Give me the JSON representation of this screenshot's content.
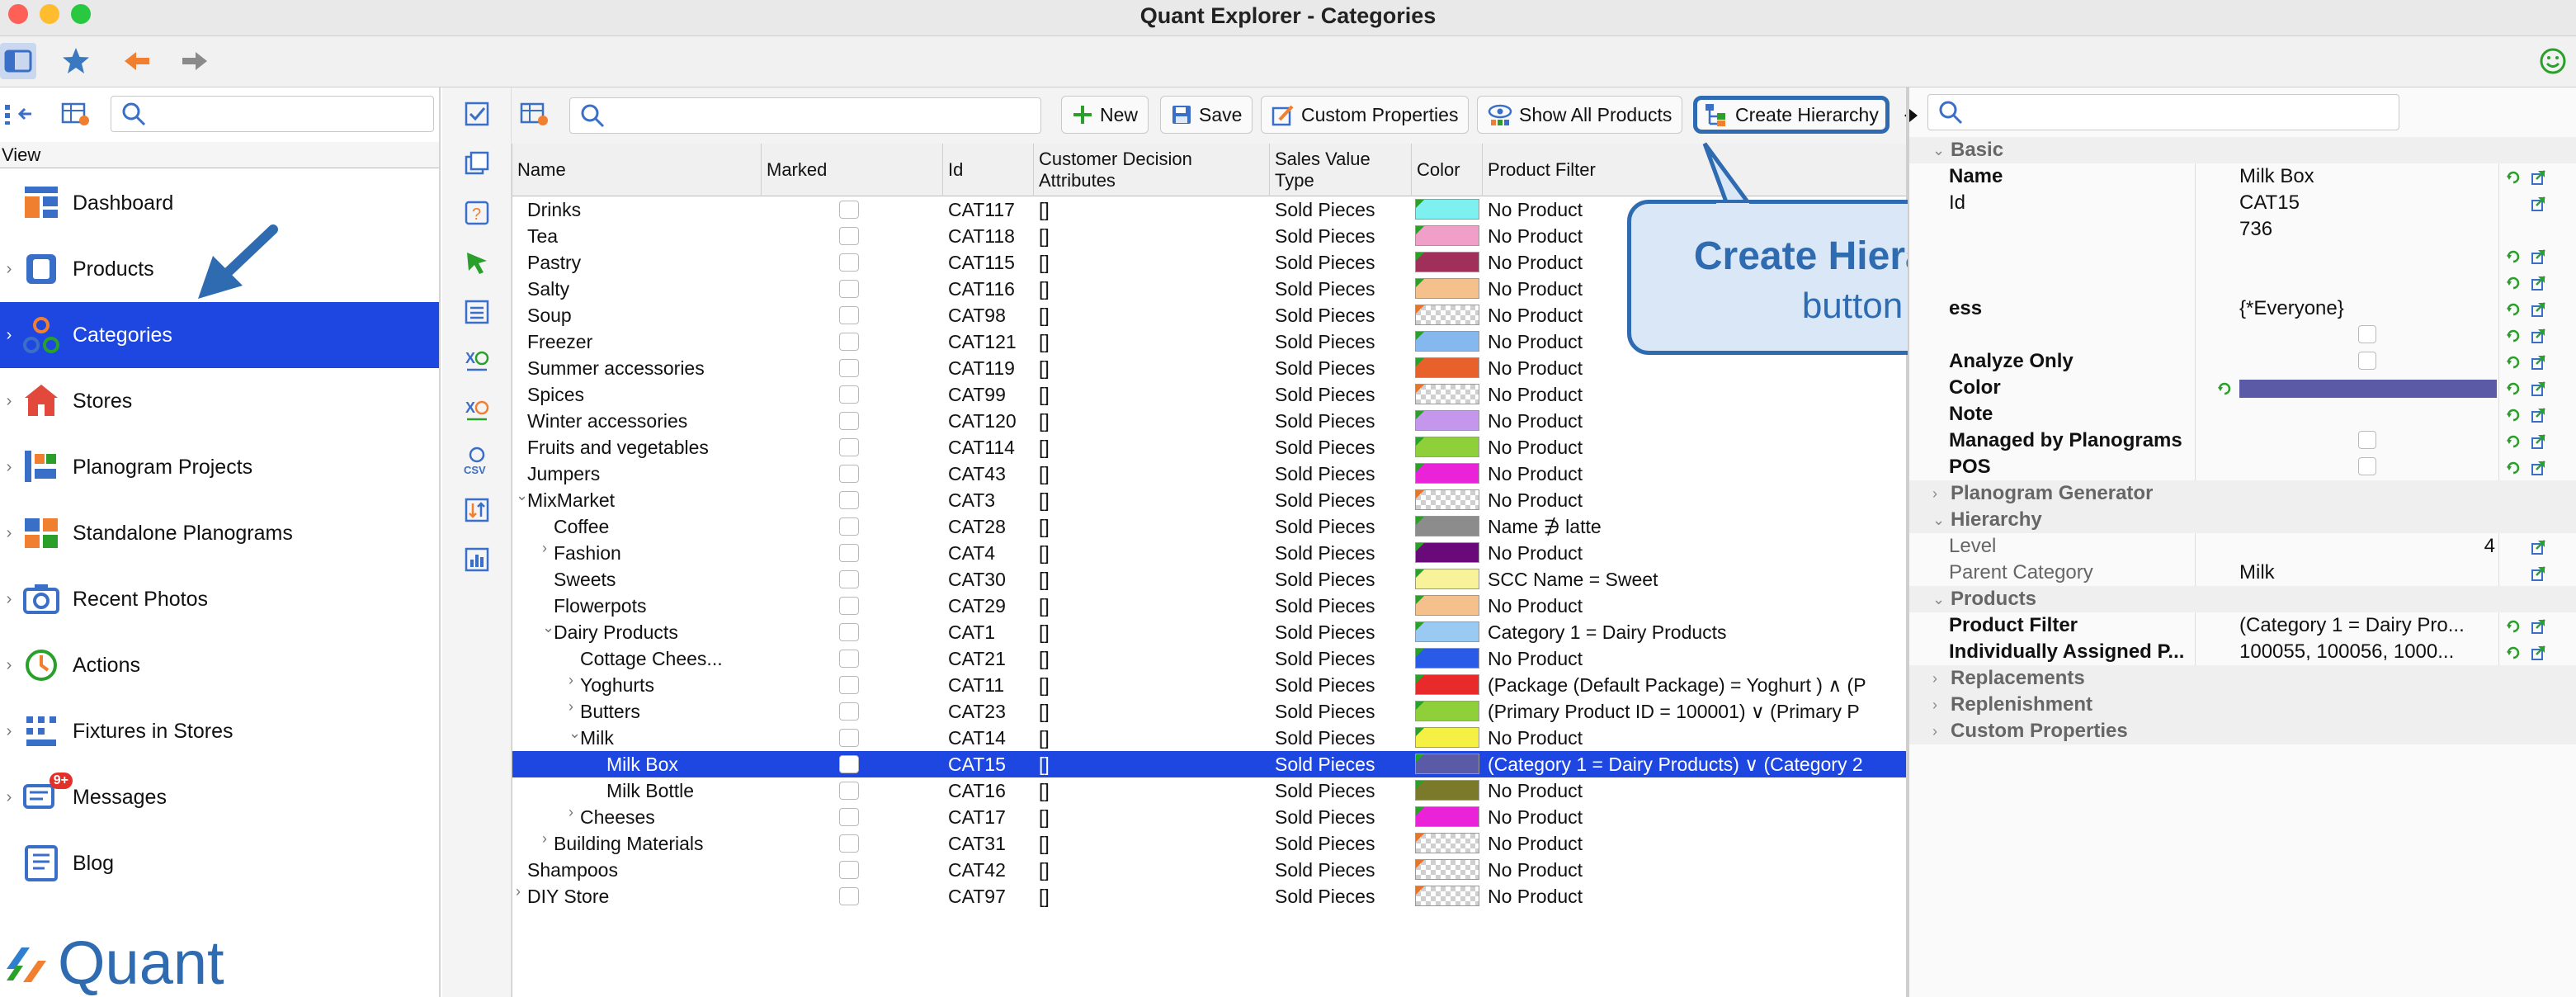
{
  "window": {
    "title": "Quant Explorer - Categories"
  },
  "left": {
    "view_label": "View",
    "nav": [
      {
        "label": "Dashboard",
        "icon": "dashboard-icon",
        "chevron": false
      },
      {
        "label": "Products",
        "icon": "products-icon",
        "chevron": true
      },
      {
        "label": "Categories",
        "icon": "categories-icon",
        "chevron": true,
        "selected": true
      },
      {
        "label": "Stores",
        "icon": "stores-icon",
        "chevron": true
      },
      {
        "label": "Planogram Projects",
        "icon": "planogram-projects-icon",
        "chevron": true
      },
      {
        "label": "Standalone Planograms",
        "icon": "standalone-planograms-icon",
        "chevron": true
      },
      {
        "label": "Recent Photos",
        "icon": "camera-icon",
        "chevron": true
      },
      {
        "label": "Actions",
        "icon": "actions-icon",
        "chevron": true
      },
      {
        "label": "Fixtures in Stores",
        "icon": "fixtures-icon",
        "chevron": true
      },
      {
        "label": "Messages",
        "icon": "messages-icon",
        "chevron": true,
        "badge": "9+"
      },
      {
        "label": "Blog",
        "icon": "blog-icon",
        "chevron": false
      }
    ],
    "logo_text": "Quant"
  },
  "center": {
    "buttons": {
      "new": "New",
      "save": "Save",
      "custom_properties": "Custom Properties",
      "show_all_products": "Show All Products",
      "create_hierarchy": "Create Hierarchy"
    },
    "columns": {
      "name": "Name",
      "marked": "Marked",
      "id": "Id",
      "cda_1": "Customer Decision",
      "cda_2": "Attributes",
      "svt_1": "Sales Value",
      "svt_2": "Type",
      "color": "Color",
      "filter": "Product Filter"
    },
    "rows": [
      {
        "name": "Drinks",
        "id": "CAT117",
        "cda": "[]",
        "svt": "Sold Pieces",
        "color": "#7ef0f0",
        "filter": "No Product",
        "indent": 0,
        "tw": ""
      },
      {
        "name": "Tea",
        "id": "CAT118",
        "cda": "[]",
        "svt": "Sold Pieces",
        "color": "#f0a0c8",
        "filter": "No Product",
        "indent": 0,
        "tw": ""
      },
      {
        "name": "Pastry",
        "id": "CAT115",
        "cda": "[]",
        "svt": "Sold Pieces",
        "color": "#a0305a",
        "filter": "No Product",
        "indent": 0,
        "tw": ""
      },
      {
        "name": "Salty",
        "id": "CAT116",
        "cda": "[]",
        "svt": "Sold Pieces",
        "color": "#f4c08c",
        "filter": "No Product",
        "indent": 0,
        "tw": ""
      },
      {
        "name": "Soup",
        "id": "CAT98",
        "cda": "[]",
        "svt": "Sold Pieces",
        "color": "checker",
        "filter": "No Product",
        "indent": 0,
        "tw": ""
      },
      {
        "name": "Freezer",
        "id": "CAT121",
        "cda": "[]",
        "svt": "Sold Pieces",
        "color": "#86b8f0",
        "filter": "No Product",
        "indent": 0,
        "tw": ""
      },
      {
        "name": "Summer accessories",
        "id": "CAT119",
        "cda": "[]",
        "svt": "Sold Pieces",
        "color": "#e8602a",
        "filter": "No Product",
        "indent": 0,
        "tw": ""
      },
      {
        "name": "Spices",
        "id": "CAT99",
        "cda": "[]",
        "svt": "Sold Pieces",
        "color": "checker",
        "filter": "No Product",
        "indent": 0,
        "tw": ""
      },
      {
        "name": "Winter accessories",
        "id": "CAT120",
        "cda": "[]",
        "svt": "Sold Pieces",
        "color": "#c496ec",
        "filter": "No Product",
        "indent": 0,
        "tw": ""
      },
      {
        "name": "Fruits and vegetables",
        "id": "CAT114",
        "cda": "[]",
        "svt": "Sold Pieces",
        "color": "#8ecf3a",
        "filter": "No Product",
        "indent": 0,
        "tw": ""
      },
      {
        "name": "Jumpers",
        "id": "CAT43",
        "cda": "[]",
        "svt": "Sold Pieces",
        "color": "#ea22d8",
        "filter": "No Product",
        "indent": 0,
        "tw": ""
      },
      {
        "name": "MixMarket",
        "id": "CAT3",
        "cda": "[]",
        "svt": "Sold Pieces",
        "color": "checker",
        "filter": "No Product",
        "indent": 0,
        "tw": "⌄"
      },
      {
        "name": "Coffee",
        "id": "CAT28",
        "cda": "[]",
        "svt": "Sold Pieces",
        "color": "#8c8c8c",
        "filter": "Name ∌ latte",
        "indent": 1,
        "tw": ""
      },
      {
        "name": "Fashion",
        "id": "CAT4",
        "cda": "[]",
        "svt": "Sold Pieces",
        "color": "#6a0a7a",
        "filter": "No Product",
        "indent": 1,
        "tw": "›"
      },
      {
        "name": "Sweets",
        "id": "CAT30",
        "cda": "[]",
        "svt": "Sold Pieces",
        "color": "#f8f39a",
        "filter": "SCC Name = Sweet",
        "indent": 1,
        "tw": ""
      },
      {
        "name": "Flowerpots",
        "id": "CAT29",
        "cda": "[]",
        "svt": "Sold Pieces",
        "color": "#f4c08c",
        "filter": "No Product",
        "indent": 1,
        "tw": ""
      },
      {
        "name": "Dairy Products",
        "id": "CAT1",
        "cda": "[]",
        "svt": "Sold Pieces",
        "color": "#9acaf2",
        "filter": "Category 1 = Dairy Products",
        "indent": 1,
        "tw": "⌄"
      },
      {
        "name": "Cottage Chees...",
        "id": "CAT21",
        "cda": "[]",
        "svt": "Sold Pieces",
        "color": "#2a5ae8",
        "filter": "No Product",
        "indent": 2,
        "tw": ""
      },
      {
        "name": "Yoghurts",
        "id": "CAT11",
        "cda": "[]",
        "svt": "Sold Pieces",
        "color": "#e82a2a",
        "filter": "(Package (Default Package) = Yoghurt ) ∧ (P",
        "indent": 2,
        "tw": "›"
      },
      {
        "name": "Butters",
        "id": "CAT23",
        "cda": "[]",
        "svt": "Sold Pieces",
        "color": "#8ecf3a",
        "filter": "(Primary Product ID = 100001) ∨ (Primary P",
        "indent": 2,
        "tw": "›"
      },
      {
        "name": "Milk",
        "id": "CAT14",
        "cda": "[]",
        "svt": "Sold Pieces",
        "color": "#f4f044",
        "filter": "No Product",
        "indent": 2,
        "tw": "⌄"
      },
      {
        "name": "Milk Box",
        "id": "CAT15",
        "cda": "[]",
        "svt": "Sold Pieces",
        "color": "#5a5aa6",
        "filter": "(Category 1 = Dairy Products) ∨ (Category 2",
        "indent": 3,
        "tw": "",
        "selected": true
      },
      {
        "name": "Milk Bottle",
        "id": "CAT16",
        "cda": "[]",
        "svt": "Sold Pieces",
        "color": "#7a7a2a",
        "filter": "No Product",
        "indent": 3,
        "tw": ""
      },
      {
        "name": "Cheeses",
        "id": "CAT17",
        "cda": "[]",
        "svt": "Sold Pieces",
        "color": "#ea22d8",
        "filter": "No Product",
        "indent": 2,
        "tw": "›"
      },
      {
        "name": "Building Materials",
        "id": "CAT31",
        "cda": "[]",
        "svt": "Sold Pieces",
        "color": "checker",
        "filter": "No Product",
        "indent": 1,
        "tw": "›"
      },
      {
        "name": "Shampoos",
        "id": "CAT42",
        "cda": "[]",
        "svt": "Sold Pieces",
        "color": "checker",
        "filter": "No Product",
        "indent": 0,
        "tw": ""
      },
      {
        "name": "DIY Store",
        "id": "CAT97",
        "cda": "[]",
        "svt": "Sold Pieces",
        "color": "checker",
        "filter": "No Product",
        "indent": 0,
        "tw": "›"
      }
    ]
  },
  "callout": {
    "title": "Create Hierarchy",
    "subtitle": "button"
  },
  "right": {
    "props": [
      {
        "type": "section",
        "label": "Basic",
        "open": true
      },
      {
        "type": "prop",
        "key": "Name",
        "value": "Milk Box",
        "bold": true,
        "icons": 2
      },
      {
        "type": "prop",
        "key": "Id",
        "value": "CAT15",
        "bold": false,
        "icons": 1
      },
      {
        "type": "prop",
        "key": "",
        "value": "736",
        "bold": false,
        "icons": 0
      },
      {
        "type": "prop",
        "key": "",
        "value": "",
        "bold": false,
        "icons": 2
      },
      {
        "type": "prop",
        "key": "",
        "value": "",
        "bold": false,
        "icons": 2
      },
      {
        "type": "prop",
        "key": "ess",
        "value": "{*Everyone}",
        "bold": true,
        "icons": 2
      },
      {
        "type": "prop",
        "key": "",
        "value": "",
        "bold": false,
        "icons": 2,
        "checkbox": true
      },
      {
        "type": "prop",
        "key": "Analyze Only",
        "value": "",
        "bold": true,
        "icons": 2,
        "checkbox": true
      },
      {
        "type": "prop",
        "key": "Color",
        "value": "",
        "bold": true,
        "icons": 2,
        "colorbar": "#5a5aa6"
      },
      {
        "type": "prop",
        "key": "Note",
        "value": "",
        "bold": true,
        "icons": 2
      },
      {
        "type": "prop",
        "key": "Managed by Planograms",
        "value": "",
        "bold": true,
        "icons": 2,
        "checkbox": true
      },
      {
        "type": "prop",
        "key": "POS",
        "value": "",
        "bold": true,
        "icons": 2,
        "checkbox": true
      },
      {
        "type": "section",
        "label": "Planogram Generator",
        "open": false
      },
      {
        "type": "section",
        "label": "Hierarchy",
        "open": true
      },
      {
        "type": "prop",
        "key": "Level",
        "value": "4",
        "bold": false,
        "grey": true,
        "icons": 1,
        "right": true
      },
      {
        "type": "prop",
        "key": "Parent Category",
        "value": "Milk",
        "bold": false,
        "grey": true,
        "icons": 1
      },
      {
        "type": "section",
        "label": "Products",
        "open": true
      },
      {
        "type": "prop",
        "key": "Product Filter",
        "value": "(Category 1 = Dairy Pro...",
        "bold": true,
        "icons": 2
      },
      {
        "type": "prop",
        "key": "Individually Assigned P...",
        "value": "100055, 100056, 1000...",
        "bold": true,
        "icons": 2
      },
      {
        "type": "section",
        "label": "Replacements",
        "open": false
      },
      {
        "type": "section",
        "label": "Replenishment",
        "open": false
      },
      {
        "type": "section",
        "label": "Custom Properties",
        "open": false
      }
    ]
  }
}
